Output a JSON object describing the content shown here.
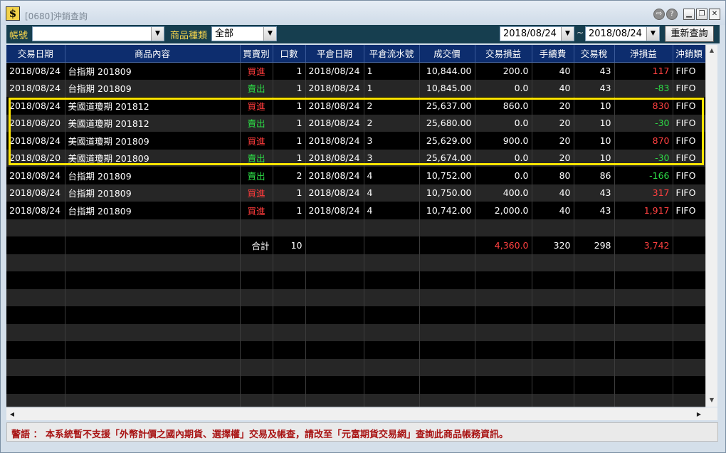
{
  "window": {
    "title": "[0680]沖銷查詢",
    "app_icon_glyph": "$"
  },
  "titlebar_buttons": {
    "tool_glyph": "⇨",
    "help_glyph": "?",
    "minimize_glyph": "▁",
    "maximize_glyph": "❐",
    "close_glyph": "✕"
  },
  "toolbar": {
    "account_label": "帳號",
    "account_value": "",
    "product_type_label": "商品種類",
    "product_type_value": "全部",
    "date_from": "2018/08/24",
    "date_sep": "~",
    "date_to": "2018/08/24",
    "requery_label": "重新查詢",
    "dropdown_glyph": "▼"
  },
  "table": {
    "columns": [
      "交易日期",
      "商品內容",
      "買賣別",
      "口數",
      "平倉日期",
      "平倉流水號",
      "成交價",
      "交易損益",
      "手續費",
      "交易稅",
      "淨損益",
      "沖銷類"
    ],
    "rows": [
      [
        "2018/08/24",
        "台指期 201809",
        "買進",
        "1",
        "2018/08/24",
        "1",
        "10,844.00",
        "200.0",
        "40",
        "43",
        "117",
        "FIFO"
      ],
      [
        "2018/08/24",
        "台指期 201809",
        "賣出",
        "1",
        "2018/08/24",
        "1",
        "10,845.00",
        "0.0",
        "40",
        "43",
        "-83",
        "FIFO"
      ],
      [
        "2018/08/24",
        "美國道瓊期 201812",
        "買進",
        "1",
        "2018/08/24",
        "2",
        "25,637.00",
        "860.0",
        "20",
        "10",
        "830",
        "FIFO"
      ],
      [
        "2018/08/20",
        "美國道瓊期 201812",
        "賣出",
        "1",
        "2018/08/24",
        "2",
        "25,680.00",
        "0.0",
        "20",
        "10",
        "-30",
        "FIFO"
      ],
      [
        "2018/08/24",
        "美國道瓊期 201809",
        "買進",
        "1",
        "2018/08/24",
        "3",
        "25,629.00",
        "900.0",
        "20",
        "10",
        "870",
        "FIFO"
      ],
      [
        "2018/08/20",
        "美國道瓊期 201809",
        "賣出",
        "1",
        "2018/08/24",
        "3",
        "25,674.00",
        "0.0",
        "20",
        "10",
        "-30",
        "FIFO"
      ],
      [
        "2018/08/24",
        "台指期 201809",
        "賣出",
        "2",
        "2018/08/24",
        "4",
        "10,752.00",
        "0.0",
        "80",
        "86",
        "-166",
        "FIFO"
      ],
      [
        "2018/08/24",
        "台指期 201809",
        "買進",
        "1",
        "2018/08/24",
        "4",
        "10,750.00",
        "400.0",
        "40",
        "43",
        "317",
        "FIFO"
      ],
      [
        "2018/08/24",
        "台指期 201809",
        "買進",
        "1",
        "2018/08/24",
        "4",
        "10,742.00",
        "2,000.0",
        "40",
        "43",
        "1,917",
        "FIFO"
      ]
    ],
    "total": {
      "label": "合計",
      "qty": "10",
      "trade_pl": "4,360.0",
      "fee": "320",
      "tax": "298",
      "net_pl": "3,742"
    },
    "empty_rows_after_total": 9
  },
  "warning": {
    "text": "警語 ： 本系統暫不支援「外幣計價之國內期貨、選擇權」交易及帳查，請改至「元富期貨交易網」查詢此商品帳務資訊。"
  },
  "colors": {
    "buy": "#ff3b3b",
    "sell": "#2ddc46",
    "header_bg": "#0d2d6e",
    "toolbar_bg": "#163e4f",
    "label_yellow": "#f7d54b",
    "highlight": "#ffe500",
    "warning_text": "#a81212"
  }
}
